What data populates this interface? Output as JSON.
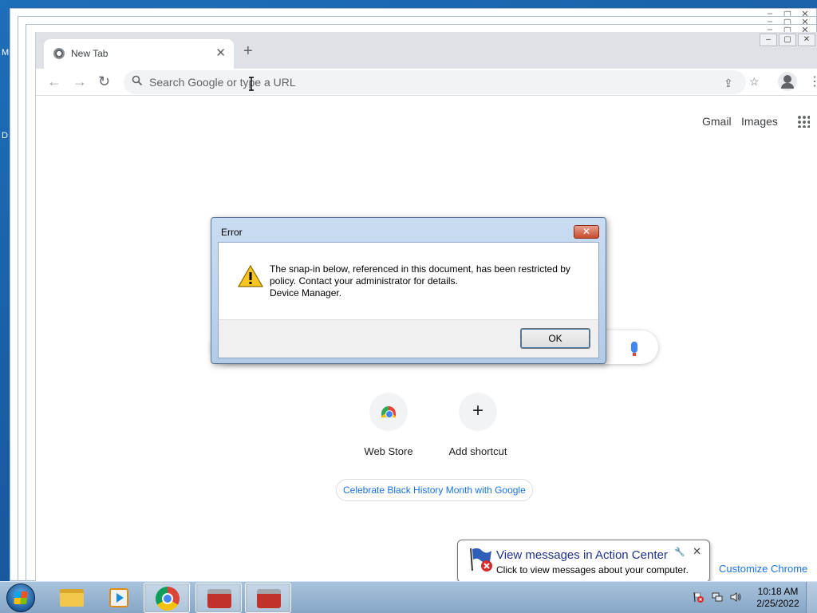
{
  "desktop": {
    "edge_letters": [
      "M",
      "D"
    ]
  },
  "browser": {
    "tab": {
      "title": "New Tab"
    },
    "omnibox": {
      "placeholder": "Search Google or type a URL"
    },
    "top_links": {
      "gmail": "Gmail",
      "images": "Images"
    },
    "shortcuts": [
      {
        "label": "Web Store"
      },
      {
        "label": "Add shortcut"
      }
    ],
    "doodle_link": "Celebrate Black History Month with Google",
    "customize": "Customize Chrome"
  },
  "dialog": {
    "title": "Error",
    "message_lines": [
      "The snap-in below, referenced in this document, has been restricted by",
      "policy. Contact your administrator for details.",
      "Device Manager."
    ],
    "ok_label": "OK"
  },
  "balloon": {
    "title": "View messages in Action Center",
    "text": "Click to view messages about your computer."
  },
  "taskbar": {
    "clock_time": "10:18 AM",
    "clock_date": "2/25/2022"
  },
  "colors": {
    "accent_link": "#1a73e8",
    "balloon_title": "#1e3287",
    "dialog_frame": "#b4cbe6"
  }
}
